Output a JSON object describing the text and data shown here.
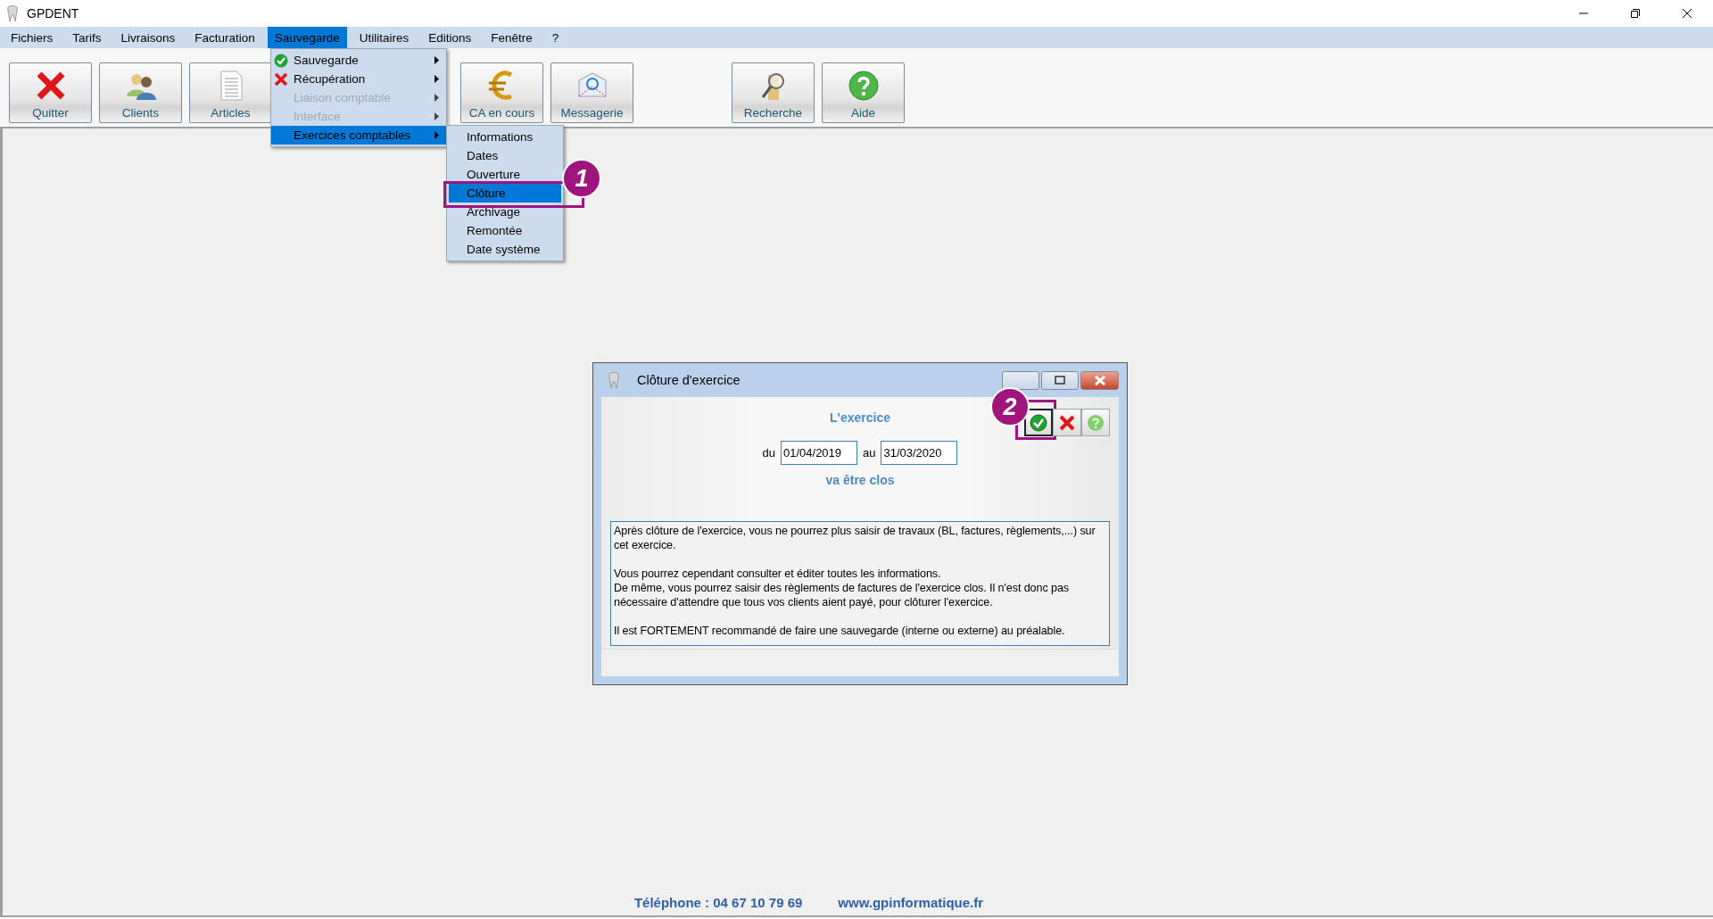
{
  "app": {
    "title": "GPDENT"
  },
  "menu_bar": [
    {
      "label": "Fichiers",
      "selected": false
    },
    {
      "label": "Tarifs",
      "selected": false
    },
    {
      "label": "Livraisons",
      "selected": false
    },
    {
      "label": "Facturation",
      "selected": false
    },
    {
      "label": "Sauvegarde",
      "selected": true
    },
    {
      "label": "Utilitaires",
      "selected": false
    },
    {
      "label": "Editions",
      "selected": false
    },
    {
      "label": "Fenêtre",
      "selected": false
    },
    {
      "label": "?",
      "selected": false
    }
  ],
  "toolbar": [
    [
      {
        "label": "Quitter",
        "kind": "quit"
      },
      {
        "label": "Clients",
        "kind": "clients"
      },
      {
        "label": "Articles",
        "kind": "articles"
      }
    ],
    [
      {
        "label": "CA en cours",
        "kind": "euro"
      },
      {
        "label": "Messagerie",
        "kind": "mail"
      }
    ],
    [
      {
        "label": "Recherche",
        "kind": "search"
      },
      {
        "label": "Aide",
        "kind": "help"
      }
    ]
  ],
  "dropdown": [
    {
      "label": "Sauvegarde",
      "kind": "check",
      "disabled": false,
      "selected": false
    },
    {
      "label": "Récupération",
      "kind": "cross",
      "disabled": false,
      "selected": false
    },
    {
      "label": "Liaison comptable",
      "kind": "plain",
      "disabled": true,
      "selected": false
    },
    {
      "label": "Interface",
      "kind": "plain",
      "disabled": true,
      "selected": false
    },
    {
      "label": "Exercices comptables",
      "kind": "plain",
      "disabled": false,
      "selected": true
    }
  ],
  "submenu": [
    {
      "label": "Informations",
      "selected": false
    },
    {
      "label": "Dates",
      "selected": false
    },
    {
      "label": "Ouverture",
      "selected": false
    },
    {
      "label": "Clôture",
      "selected": true,
      "callout": "1"
    },
    {
      "label": "Archivage",
      "selected": false
    },
    {
      "label": "Remontée",
      "selected": false
    },
    {
      "label": "Date système",
      "selected": false
    }
  ],
  "dialog": {
    "title": "Clôture d'exercice",
    "heading": "L'exercice",
    "from_label": "du",
    "from_value": "01/04/2019",
    "to_label": "au",
    "to_value": "31/03/2020",
    "status": "va être clos",
    "actions": [
      {
        "kind": "validate",
        "focused": true,
        "callout": "2"
      },
      {
        "kind": "cancel",
        "focused": false
      },
      {
        "kind": "help",
        "focused": false
      }
    ],
    "message": [
      "Après clôture de l'exercice, vous ne pourrez plus saisir de travaux (BL, factures, règlements,...) sur cet exercice.",
      "Vous pourrez cependant consulter et éditer toutes les informations.\nDe même, vous pourrez saisir des règlements de factures de l'exercice clos. Il n'est donc pas nécessaire d'attendre que tous vos clients aient payé, pour clôturer l'exercice.",
      "Il est FORTEMENT recommandé de faire une sauvegarde (interne ou externe) au préalable."
    ]
  },
  "footer": {
    "phone": "Téléphone : 04 67 10 79 69",
    "website": "www.gpinformatique.fr"
  }
}
